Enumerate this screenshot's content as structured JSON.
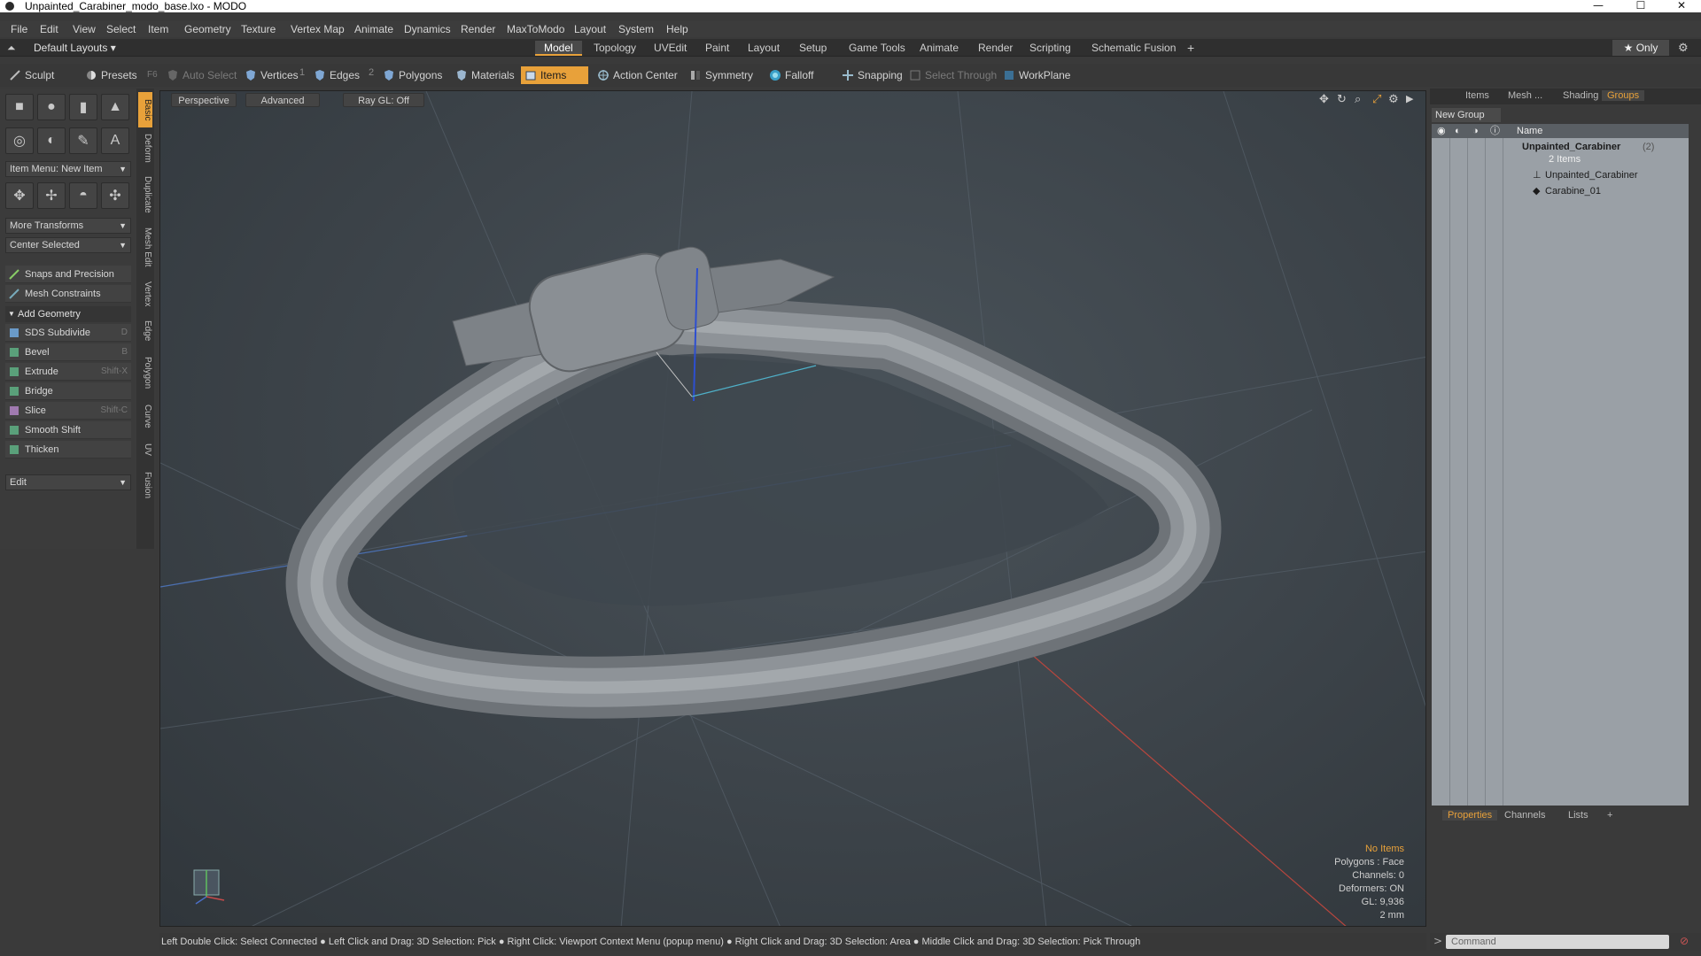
{
  "window": {
    "title": "Unpainted_Carabiner_modo_base.lxo - MODO",
    "minimize": "—",
    "maximize": "☐",
    "close": "✕"
  },
  "menu": [
    "File",
    "Edit",
    "View",
    "Select",
    "Item",
    "Geometry",
    "Texture",
    "Vertex Map",
    "Animate",
    "Dynamics",
    "Render",
    "MaxToModo",
    "Layout",
    "System",
    "Help"
  ],
  "layout_bar": {
    "default_layouts": "Default Layouts ▾",
    "tabs": [
      "Model",
      "Topology",
      "UVEdit",
      "Paint",
      "Layout",
      "Setup",
      "Game Tools",
      "Animate",
      "Render",
      "Scripting",
      "Schematic Fusion"
    ],
    "active_tab": "Model",
    "add": "+",
    "only": "★  Only"
  },
  "toolbar": {
    "sculpt": "Sculpt",
    "presets": "Presets",
    "presets_key": "F6",
    "auto_select": "Auto Select",
    "vertices": "Vertices",
    "vertices_num": "1",
    "edges": "Edges",
    "edges_num": "2",
    "polygons": "Polygons",
    "materials": "Materials",
    "items": "Items",
    "action_center": "Action Center",
    "symmetry": "Symmetry",
    "falloff": "Falloff",
    "snapping": "Snapping",
    "select_through": "Select Through",
    "workplane": "WorkPlane"
  },
  "left_panel": {
    "item_menu": "Item Menu: New Item",
    "more_transforms": "More Transforms",
    "center_selected": "Center Selected",
    "snaps_precision": "Snaps and Precision",
    "mesh_constraints": "Mesh Constraints",
    "add_geometry": "Add Geometry",
    "tools": [
      {
        "label": "SDS Subdivide",
        "shortcut": "D"
      },
      {
        "label": "Bevel",
        "shortcut": "B"
      },
      {
        "label": "Extrude",
        "shortcut": "Shift-X"
      },
      {
        "label": "Bridge",
        "shortcut": ""
      },
      {
        "label": "Slice",
        "shortcut": "Shift-C"
      },
      {
        "label": "Smooth Shift",
        "shortcut": ""
      },
      {
        "label": "Thicken",
        "shortcut": ""
      }
    ],
    "edit": "Edit"
  },
  "vertical_tabs": [
    "Basic",
    "Deform",
    "Duplicate",
    "Mesh Edit",
    "Vertex",
    "Edge",
    "Polygon",
    "Curve",
    "UV",
    "Fusion"
  ],
  "viewport": {
    "perspective": "Perspective",
    "advanced": "Advanced",
    "raygl": "Ray GL: Off",
    "info": {
      "no_items": "No Items",
      "polygons": "Polygons : Face",
      "channels": "Channels: 0",
      "deformers": "Deformers: ON",
      "gl": "GL: 9,936",
      "scale": "2 mm"
    }
  },
  "right_panel": {
    "tabs": [
      "Items",
      "Mesh ...",
      "Shading",
      "Groups"
    ],
    "active_tab": "Groups",
    "new_group": "New Group",
    "col_name": "Name",
    "group_name": "Unpainted_Carabiner",
    "group_count": "(2)",
    "group_items": "2 Items",
    "children": [
      "Unpainted_Carabiner",
      "Carabine_01"
    ]
  },
  "props_panel": {
    "tabs": [
      "Properties",
      "Channels",
      "Lists"
    ],
    "active_tab": "Properties",
    "add": "+"
  },
  "status_bar": {
    "text": "Left Double Click: Select Connected ● Left Click and Drag: 3D Selection: Pick ● Right Click: Viewport Context Menu (popup menu) ● Right Click and Drag: 3D Selection: Area ● Middle Click and Drag: 3D Selection: Pick Through"
  },
  "command": {
    "placeholder": "Command"
  },
  "colors": {
    "accent": "#e8a13a"
  }
}
